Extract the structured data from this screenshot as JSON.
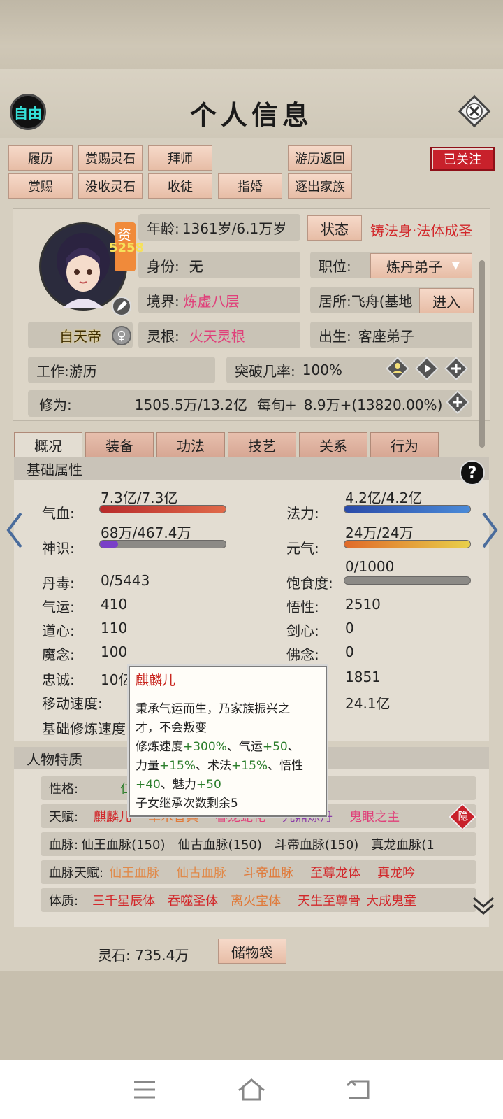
{
  "header": {
    "free_badge": "自由",
    "title": "个人信息"
  },
  "actions": {
    "row1": [
      "履历",
      "赏赐灵石",
      "拜师",
      "游历返回"
    ],
    "row2": [
      "赏赐",
      "没收灵石",
      "收徒",
      "指婚",
      "逐出家族"
    ],
    "follow": "已关注"
  },
  "profile": {
    "aptitude_label": "资",
    "aptitude_value": "5258",
    "sect_name": "自天帝",
    "age_label": "年龄:",
    "age_value": "1361岁/6.1万岁",
    "status_button": "状态",
    "status_text": "铸法身·法体成圣",
    "identity_label": "身份:",
    "identity_value": "无",
    "position_label": "职位:",
    "position_value": "炼丹弟子",
    "realm_label": "境界:",
    "realm_value": "炼虚八层",
    "residence_label": "居所:",
    "residence_value": "飞舟(基地",
    "enter_button": "进入",
    "root_label": "灵根:",
    "root_value": "火天灵根",
    "birth_label": "出生:",
    "birth_value": "客座弟子",
    "work_label": "工作:",
    "work_value": "游历",
    "breakthrough_label": "突破几率:",
    "breakthrough_value": "100%",
    "cultivation_label": "修为:",
    "cultivation_value": "1505.5万/13.2亿",
    "per_period_label": "每旬+",
    "per_period_value": "8.9万+(13820.00%)"
  },
  "tabs": [
    "概况",
    "装备",
    "功法",
    "技艺",
    "关系",
    "行为"
  ],
  "basic": {
    "title": "基础属性",
    "help": "?",
    "blood_label": "气血:",
    "blood_value": "7.3亿/7.3亿",
    "blood_fill": 1.0,
    "mana_label": "法力:",
    "mana_value": "4.2亿/4.2亿",
    "mana_fill": 1.0,
    "sense_label": "神识:",
    "sense_value": "68万/467.4万",
    "sense_fill": 0.145,
    "vitality_label": "元气:",
    "vitality_value": "24万/24万",
    "vitality_fill": 1.0,
    "poison_label": "丹毒:",
    "poison_value": "0/5443",
    "satiety_label": "饱食度:",
    "satiety_value": "0/1000",
    "satiety_fill": 0.0,
    "luck_label": "气运:",
    "luck_value": "410",
    "insight_label": "悟性:",
    "insight_value": "2510",
    "dao_label": "道心:",
    "dao_value": "110",
    "sword_label": "剑心:",
    "sword_value": "0",
    "demon_label": "魔念:",
    "demon_value": "100",
    "buddha_label": "佛念:",
    "buddha_value": "0",
    "loyal_label": "忠诚:",
    "loyal_value": "10亿",
    "right5_value": "1851",
    "move_label": "移动速度:",
    "right6_value": "24.1亿",
    "base_speed_label": "基础修炼速度:"
  },
  "traits": {
    "title": "人物特质",
    "personality_label": "性格:",
    "personality_value": "仁",
    "talent_label": "天赋:",
    "talents": [
      "麒麟儿",
      "草木香具",
      "春龙蛇花",
      "九鼎炼丹",
      "鬼眼之主"
    ],
    "hide_badge": "隐",
    "blood_label": "血脉:",
    "bloods": [
      "仙王血脉(150)",
      "仙古血脉(150)",
      "斗帝血脉(150)",
      "真龙血脉(1"
    ],
    "blood_talent_label": "血脉天赋:",
    "blood_talents": [
      "仙王血脉",
      "仙古血脉",
      "斗帝血脉",
      "至尊龙体",
      "真龙吟"
    ],
    "body_label": "体质:",
    "bodies": [
      "三千星辰体",
      "吞噬圣体",
      "离火宝体",
      "天生至尊骨",
      "大成鬼童"
    ]
  },
  "tooltip": {
    "title": "麒麟儿",
    "line1": "秉承气运而生，乃家族振兴之",
    "line2": "才，不会叛变",
    "line3a": "修炼速度",
    "line3b": "+300%",
    "line3c": "、气运",
    "line3d": "+50",
    "line3e": "、",
    "line4a": "力量",
    "line4b": "+15%",
    "line4c": "、术法",
    "line4d": "+15%",
    "line4e": "、悟性",
    "line5a": "+40",
    "line5b": "、魅力",
    "line5c": "+50",
    "line6": "子女继承次数剩余5"
  },
  "footer": {
    "stones_label": "灵石:",
    "stones_value": "735.4万",
    "bag_button": "储物袋"
  },
  "colors": {
    "accent_red": "#c8212b",
    "pink": "#e0407a",
    "orange": "#e07a3a",
    "purple": "#8b3fa8",
    "green": "#2a7d2a"
  }
}
